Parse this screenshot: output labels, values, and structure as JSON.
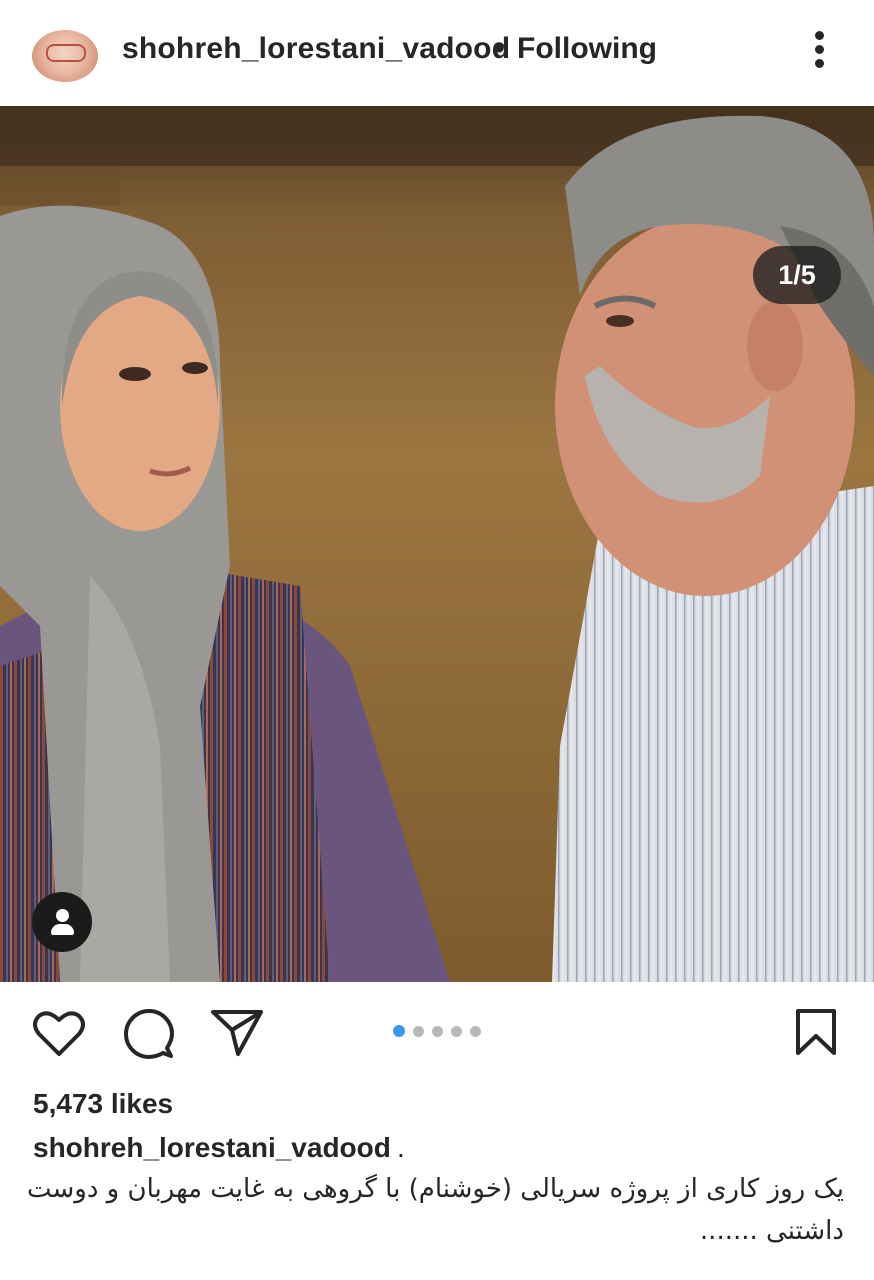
{
  "header": {
    "username": "shohreh_lorestani_vadood",
    "separator": "•",
    "follow_status": "Following",
    "more_icon": "more-vertical-icon"
  },
  "post": {
    "image_counter": "1/5",
    "tag_icon": "user-tag-icon",
    "carousel": {
      "total": 5,
      "active_index": 0,
      "active_color": "#3897f0"
    }
  },
  "actions": {
    "like_icon": "heart-icon",
    "comment_icon": "comment-icon",
    "share_icon": "send-icon",
    "save_icon": "bookmark-icon"
  },
  "likes": "5,473 likes",
  "caption": {
    "username": "shohreh_lorestani_vadood",
    "suffix": ".",
    "text": "یک روز کاری از پروژه سریالی (خوشنام) با گروهی به غایت مهربان و دوست داشتنی ......."
  }
}
